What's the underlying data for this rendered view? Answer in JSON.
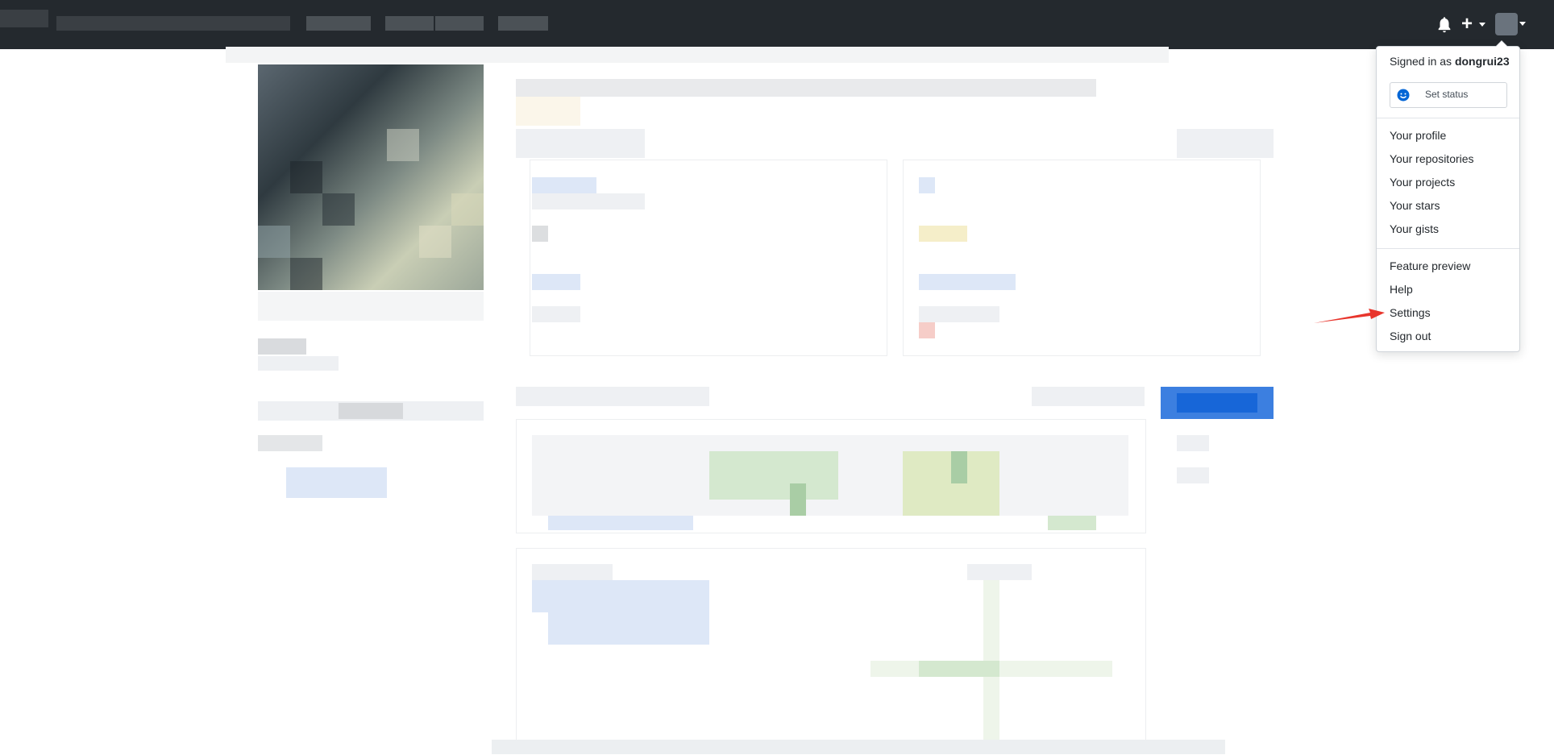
{
  "header": {
    "icons": {
      "notifications": "bell-icon",
      "create": "plus-icon",
      "avatar": "avatar"
    }
  },
  "dropdown": {
    "signed_in_prefix": "Signed in as",
    "username": "dongrui23",
    "set_status": "Set status",
    "items": [
      "Your profile",
      "Your repositories",
      "Your projects",
      "Your stars",
      "Your gists"
    ],
    "secondary": [
      "Feature preview",
      "Help",
      "Settings",
      "Sign out"
    ]
  },
  "annotation": {
    "color": "#e8352c",
    "target": "Settings"
  },
  "colors": {
    "header_bg": "#24292e",
    "accent_blue": "#1766d8"
  }
}
